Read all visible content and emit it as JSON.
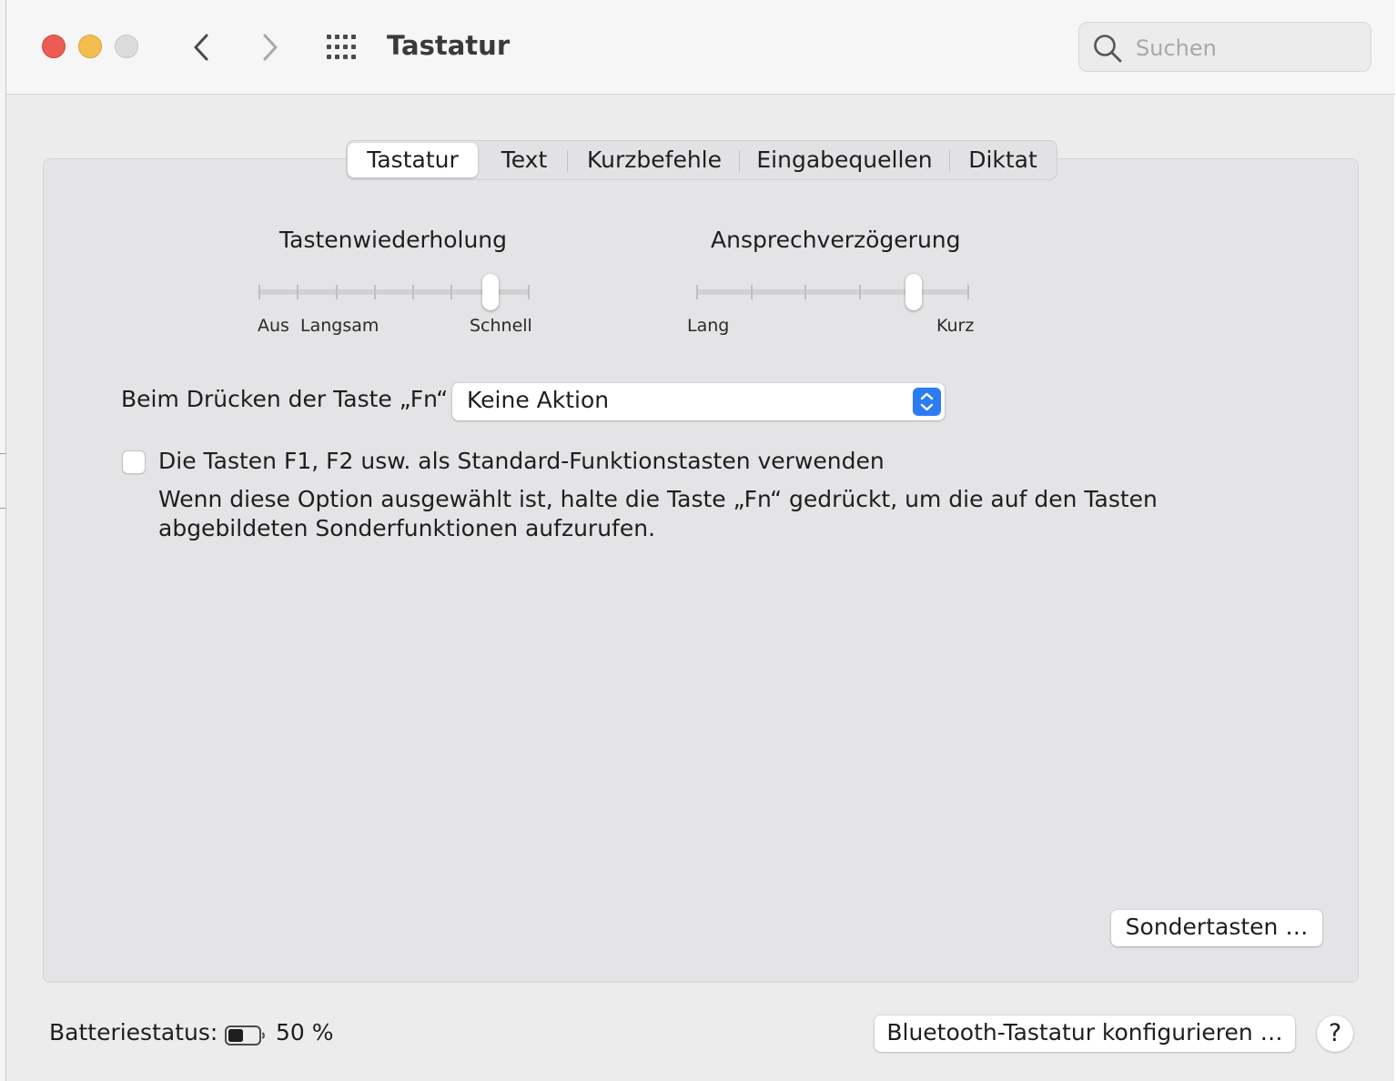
{
  "window": {
    "title": "Tastatur",
    "search_placeholder": "Suchen"
  },
  "tabs": [
    {
      "label": "Tastatur",
      "active": true
    },
    {
      "label": "Text",
      "active": false
    },
    {
      "label": "Kurzbefehle",
      "active": false
    },
    {
      "label": "Eingabequellen",
      "active": false
    },
    {
      "label": "Diktat",
      "active": false
    }
  ],
  "key_repeat": {
    "title": "Tastenwiederholung",
    "labels": [
      "Aus",
      "Langsam",
      "Schnell"
    ],
    "steps": 8,
    "selected_step": 7
  },
  "delay_until_repeat": {
    "title": "Ansprechverzögerung",
    "labels": [
      "Lang",
      "Kurz"
    ],
    "steps": 6,
    "selected_step": 5
  },
  "fn_key": {
    "label": "Beim Drücken der Taste „Fn“",
    "value": "Keine Aktion"
  },
  "function_keys": {
    "checked": false,
    "label": "Die Tasten F1, F2 usw. als Standard-Funktionstasten verwenden",
    "description": "Wenn diese Option ausgewählt ist, halte die Taste „Fn“ gedrückt, um die auf den Tasten abgebildeten Sonderfunktionen aufzurufen."
  },
  "modifier_button": "Sondertasten …",
  "battery": {
    "label": "Batteriestatus:",
    "value": "50 %",
    "level": 0.5
  },
  "bluetooth_button": "Bluetooth-Tastatur konfigurieren …",
  "help_button": "?",
  "colors": {
    "accent": "#2c7cf6",
    "close": "#ee5b53",
    "minimize": "#f4be4f",
    "zoom_disabled": "#dcdcdc"
  }
}
